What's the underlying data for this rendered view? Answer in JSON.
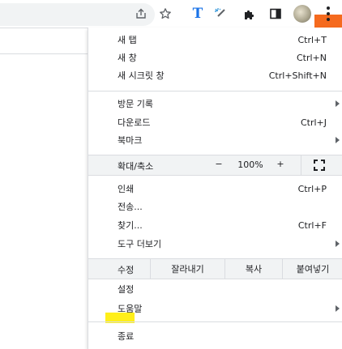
{
  "colors": {
    "accent": "#1a73e8",
    "menu_button_highlight": "#f56a1e",
    "settings_highlight": "#ffef1a"
  },
  "toolbar": {
    "icons": [
      "share-icon",
      "bookmark-star-icon",
      "text-extension-icon",
      "magic-wand-extension-icon",
      "puzzle-extensions-icon",
      "side-panel-icon",
      "profile-avatar",
      "more-menu-icon"
    ],
    "extension_t_label": "T"
  },
  "menu": {
    "new_tab": {
      "label": "새 탭",
      "shortcut": "Ctrl+T"
    },
    "new_window": {
      "label": "새 창",
      "shortcut": "Ctrl+N"
    },
    "new_incognito": {
      "label": "새 시크릿 창",
      "shortcut": "Ctrl+Shift+N"
    },
    "history": {
      "label": "방문 기록"
    },
    "downloads": {
      "label": "다운로드",
      "shortcut": "Ctrl+J"
    },
    "bookmarks": {
      "label": "북마크"
    },
    "zoom": {
      "label": "확대/축소",
      "minus": "−",
      "level": "100%",
      "plus": "+"
    },
    "print": {
      "label": "인쇄",
      "shortcut": "Ctrl+P"
    },
    "cast": {
      "label": "전송..."
    },
    "find": {
      "label": "찾기...",
      "shortcut": "Ctrl+F"
    },
    "more_tools": {
      "label": "도구 더보기"
    },
    "edit": {
      "label": "수정",
      "cut": "잘라내기",
      "copy": "복사",
      "paste": "붙여넣기"
    },
    "settings": {
      "label": "설정"
    },
    "help": {
      "label": "도움말"
    },
    "exit": {
      "label": "종료"
    }
  }
}
